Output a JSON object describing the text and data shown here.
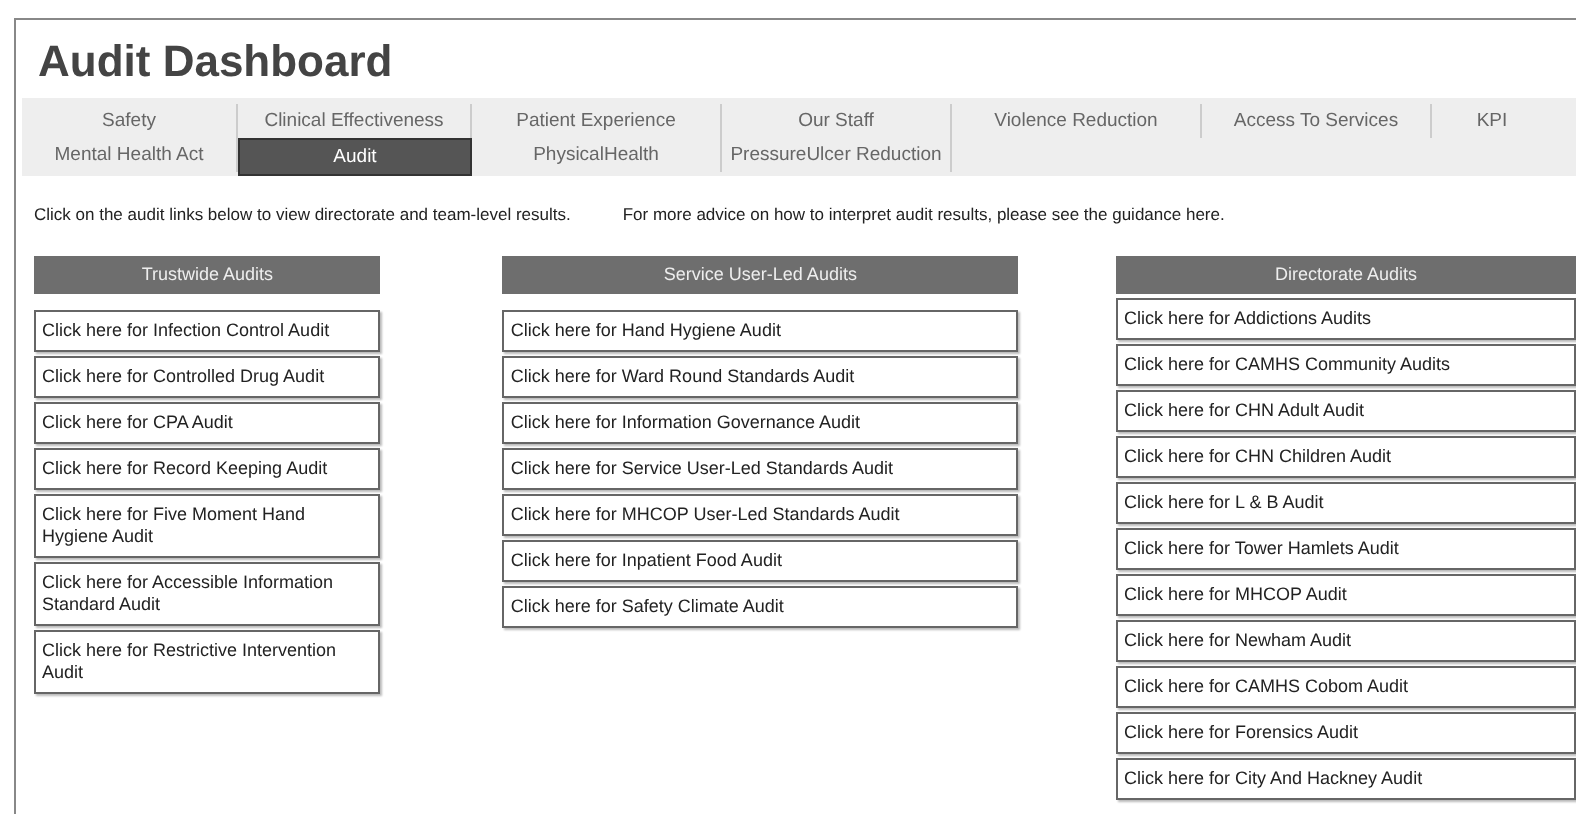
{
  "title": "Audit Dashboard",
  "tabs": [
    [
      {
        "label": "Safety",
        "selected": false
      },
      {
        "label": "Clinical Effectiveness",
        "selected": false
      },
      {
        "label": "Patient Experience",
        "selected": false
      },
      {
        "label": "Our Staff",
        "selected": false
      },
      {
        "label": "Violence Reduction",
        "selected": false
      },
      {
        "label": "Access To Services",
        "selected": false
      },
      {
        "label": "KPI",
        "selected": false
      }
    ],
    [
      {
        "label": "Mental Health Act",
        "selected": false
      },
      {
        "label": "Audit",
        "selected": true
      },
      {
        "label": "PhysicalHealth",
        "selected": false
      },
      {
        "label": "PressureUlcer Reduction",
        "selected": false
      }
    ]
  ],
  "intro": "Click on the audit links below to view directorate and team-level results.",
  "advice": "For more advice on how to interpret audit results, please see the guidance here.",
  "columns": [
    {
      "heading": "Trustwide Audits",
      "links": [
        "Click here for Infection Control Audit",
        "Click here for Controlled Drug Audit",
        "Click here for CPA Audit",
        "Click here for Record Keeping Audit",
        "Click here for Five Moment Hand Hygiene Audit",
        "Click here for Accessible Information Standard Audit",
        "Click here for Restrictive Intervention Audit"
      ]
    },
    {
      "heading": "Service User-Led Audits",
      "links": [
        "Click here for Hand Hygiene Audit",
        "Click here for Ward Round Standards Audit",
        "Click here for Information Governance Audit",
        "Click here for Service User-Led Standards Audit",
        "Click here for MHCOP User-Led Standards Audit",
        "Click here for Inpatient Food Audit",
        "Click here for Safety Climate Audit"
      ]
    },
    {
      "heading": "Directorate Audits",
      "links": [
        "Click here for Addictions Audits",
        "Click here for CAMHS Community Audits",
        "Click here for CHN Adult Audit",
        "Click here for CHN Children Audit",
        "Click here for L & B Audit",
        "Click here for Tower Hamlets Audit",
        "Click here for MHCOP Audit",
        "Click here for Newham Audit",
        "Click here for CAMHS Cobom Audit",
        "Click here for Forensics Audit",
        "Click here for City And Hackney Audit"
      ]
    }
  ]
}
